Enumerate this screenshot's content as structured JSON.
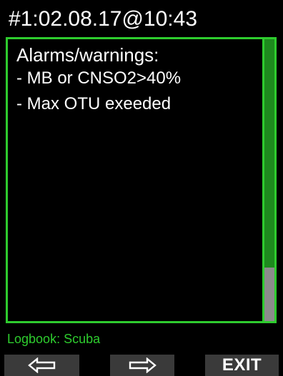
{
  "header": {
    "title": "#1:02.08.17@10:43"
  },
  "alarms": {
    "title": "Alarms/warnings:",
    "items": [
      "- MB or CNSO2>40%",
      "- Max OTU exeeded"
    ]
  },
  "scroll": {
    "position_fraction": 0.81,
    "thumb_fraction": 0.19
  },
  "footer": {
    "label": "Logbook: Scuba"
  },
  "softkeys": {
    "left_icon": "left-arrow-outline",
    "center_icon": "right-arrow-outline",
    "right_label": "EXIT"
  },
  "colors": {
    "accent": "#2ecc2e",
    "scroll_track": "#1e8a1e",
    "scroll_thumb": "#8c8c8c",
    "softkey_bg": "#3a3a3a",
    "background": "#000000",
    "text": "#ffffff"
  }
}
